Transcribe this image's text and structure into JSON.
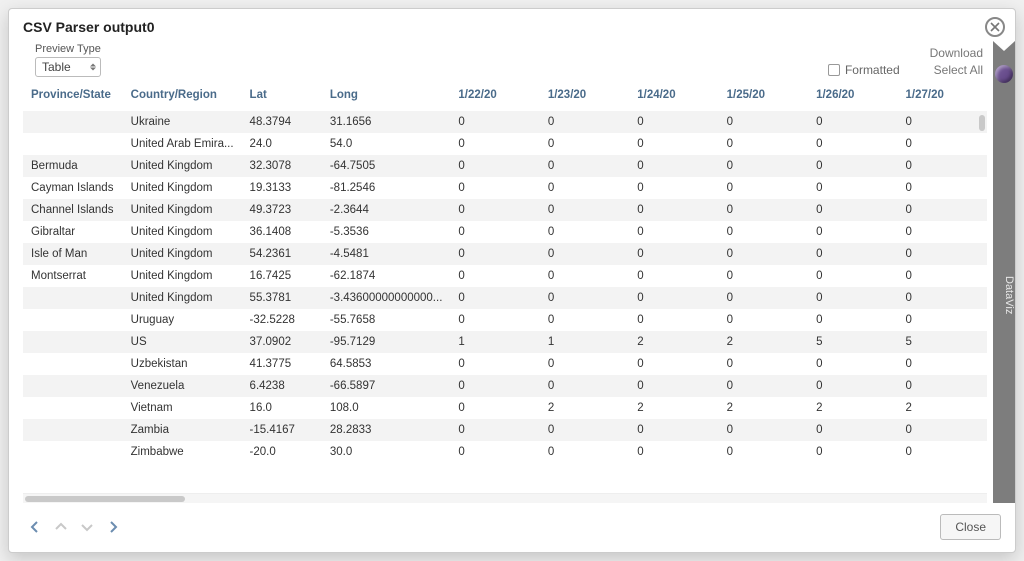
{
  "modal": {
    "title": "CSV Parser output0",
    "close_btn": "Close"
  },
  "preview": {
    "label": "Preview Type",
    "value": "Table"
  },
  "controls": {
    "formatted_label": "Formatted",
    "download": "Download",
    "select_all": "Select All"
  },
  "side_tab": {
    "label": "DataViz"
  },
  "table": {
    "columns": [
      "Province/State",
      "Country/Region",
      "Lat",
      "Long",
      "1/22/20",
      "1/23/20",
      "1/24/20",
      "1/25/20",
      "1/26/20",
      "1/27/20"
    ],
    "rows": [
      [
        "",
        "Ukraine",
        "48.3794",
        "31.1656",
        "0",
        "0",
        "0",
        "0",
        "0",
        "0"
      ],
      [
        "",
        "United Arab Emira...",
        "24.0",
        "54.0",
        "0",
        "0",
        "0",
        "0",
        "0",
        "0"
      ],
      [
        "Bermuda",
        "United Kingdom",
        "32.3078",
        "-64.7505",
        "0",
        "0",
        "0",
        "0",
        "0",
        "0"
      ],
      [
        "Cayman Islands",
        "United Kingdom",
        "19.3133",
        "-81.2546",
        "0",
        "0",
        "0",
        "0",
        "0",
        "0"
      ],
      [
        "Channel Islands",
        "United Kingdom",
        "49.3723",
        "-2.3644",
        "0",
        "0",
        "0",
        "0",
        "0",
        "0"
      ],
      [
        "Gibraltar",
        "United Kingdom",
        "36.1408",
        "-5.3536",
        "0",
        "0",
        "0",
        "0",
        "0",
        "0"
      ],
      [
        "Isle of Man",
        "United Kingdom",
        "54.2361",
        "-4.5481",
        "0",
        "0",
        "0",
        "0",
        "0",
        "0"
      ],
      [
        "Montserrat",
        "United Kingdom",
        "16.7425",
        "-62.1874",
        "0",
        "0",
        "0",
        "0",
        "0",
        "0"
      ],
      [
        "",
        "United Kingdom",
        "55.3781",
        "-3.43600000000000...",
        "0",
        "0",
        "0",
        "0",
        "0",
        "0"
      ],
      [
        "",
        "Uruguay",
        "-32.5228",
        "-55.7658",
        "0",
        "0",
        "0",
        "0",
        "0",
        "0"
      ],
      [
        "",
        "US",
        "37.0902",
        "-95.7129",
        "1",
        "1",
        "2",
        "2",
        "5",
        "5"
      ],
      [
        "",
        "Uzbekistan",
        "41.3775",
        "64.5853",
        "0",
        "0",
        "0",
        "0",
        "0",
        "0"
      ],
      [
        "",
        "Venezuela",
        "6.4238",
        "-66.5897",
        "0",
        "0",
        "0",
        "0",
        "0",
        "0"
      ],
      [
        "",
        "Vietnam",
        "16.0",
        "108.0",
        "0",
        "2",
        "2",
        "2",
        "2",
        "2"
      ],
      [
        "",
        "Zambia",
        "-15.4167",
        "28.2833",
        "0",
        "0",
        "0",
        "0",
        "0",
        "0"
      ],
      [
        "",
        "Zimbabwe",
        "-20.0",
        "30.0",
        "0",
        "0",
        "0",
        "0",
        "0",
        "0"
      ]
    ]
  }
}
